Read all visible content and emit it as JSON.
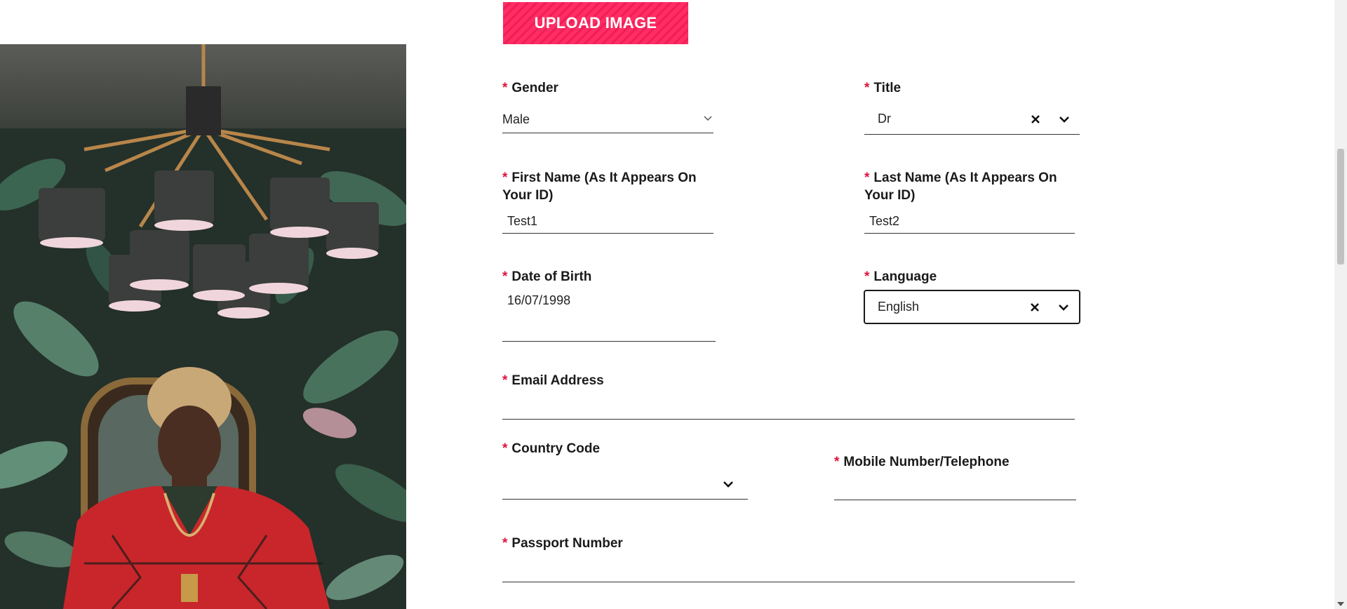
{
  "upload": {
    "label": "UPLOAD IMAGE"
  },
  "required_mark": "*",
  "gender": {
    "label": "Gender",
    "value": "Male"
  },
  "title": {
    "label": "Title",
    "value": "Dr"
  },
  "first_name": {
    "label_line1": "First Name (As It Appears On",
    "label_line2": "Your ID)",
    "value": "Test1"
  },
  "last_name": {
    "label_line1": "Last Name (As It Appears On",
    "label_line2": "Your ID)",
    "value": "Test2"
  },
  "dob": {
    "label": "Date of Birth",
    "value": "16/07/1998"
  },
  "language": {
    "label": "Language",
    "value": "English"
  },
  "email": {
    "label": "Email Address",
    "value": ""
  },
  "country_code": {
    "label": "Country Code",
    "value": ""
  },
  "mobile": {
    "label": "Mobile Number/Telephone",
    "value": ""
  },
  "passport": {
    "label": "Passport Number",
    "value": ""
  },
  "colors": {
    "accent": "#ff1f5a",
    "required": "#e0123d",
    "text": "#1a1a1a"
  },
  "icons": {
    "clear": "close-icon",
    "dropdown": "chevron-down-icon"
  }
}
